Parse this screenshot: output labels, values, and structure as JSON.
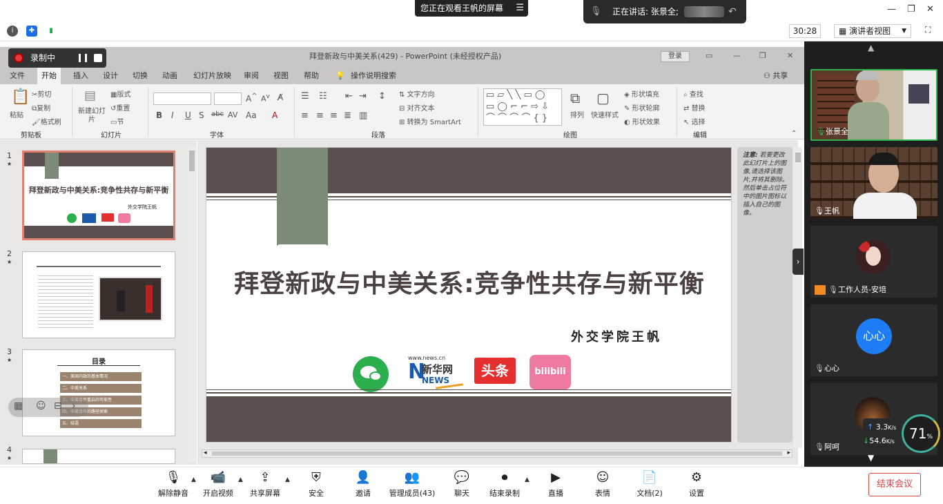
{
  "meeting": {
    "watching_text": "您正在观看王帆的屏幕",
    "speaking_text": "正在讲话: 张景全;",
    "timer": "30:28",
    "view_mode": "演讲者视图"
  },
  "recording": {
    "label": "录制中"
  },
  "powerpoint": {
    "title": "拜登新政与中美关系(429)  -  PowerPoint (未经授权产品)",
    "login": "登录",
    "tabs": [
      "文件",
      "开始",
      "插入",
      "设计",
      "切换",
      "动画",
      "幻灯片放映",
      "审阅",
      "视图",
      "帮助",
      "操作说明搜索"
    ],
    "share": "共享",
    "ribbon": {
      "paste": "粘贴",
      "cut": "剪切",
      "copy": "复制",
      "format_painter": "格式刷",
      "new_slide": "新建幻灯片",
      "layout": "版式",
      "reset": "重置",
      "section": "节",
      "text_direction": "文字方向",
      "align_text": "对齐文本",
      "smartart": "转换为 SmartArt",
      "arrange": "排列",
      "quick_styles": "快速样式",
      "shape_fill": "形状填充",
      "shape_outline": "形状轮廓",
      "shape_effects": "形状效果",
      "find": "查找",
      "replace": "替换",
      "select": "选择",
      "groups": [
        "剪贴板",
        "幻灯片",
        "字体",
        "段落",
        "绘图",
        "编辑"
      ]
    },
    "thumbs": [
      {
        "num": "1",
        "star": "★",
        "title": "拜登新政与中美关系:竞争性共存与新平衡",
        "author": "外交学院王帆"
      },
      {
        "num": "2",
        "star": "★"
      },
      {
        "num": "3",
        "star": "★",
        "title": "目录",
        "items": [
          "一、美国内政的基本情况",
          "二、中美关系",
          "三、中美合作重启的可能性",
          "四、中美合作的路径探索",
          "五、结语"
        ]
      },
      {
        "num": "4",
        "star": "★"
      }
    ],
    "slide": {
      "title": "拜登新政与中美关系:竞争性共存与新平衡",
      "author": "外交学院王帆",
      "logo_news_url": "www.news.cn",
      "logo_news_name": "新华网",
      "logo_news_letters": "NEWS",
      "logo_toutiao": "头条",
      "logo_bilibili": "bilibili"
    },
    "note": {
      "label": "注意:",
      "text": "若要更改此幻灯片上的图像,请选择该图片,并将其删除。然后单击占位符中的图片图标以插入自己的图像。"
    }
  },
  "participants": [
    {
      "name": "张景全",
      "muted": false
    },
    {
      "name": "王帆",
      "muted": false
    },
    {
      "name": "工作人员-安培",
      "muted": true
    },
    {
      "name": "心心",
      "muted": true,
      "avatar": "心心"
    },
    {
      "name": "阿呵",
      "muted": true
    }
  ],
  "network": {
    "up": "3.3",
    "up_unit": "K/s",
    "down": "54.6",
    "down_unit": "K/s",
    "cpu": "71",
    "cpu_unit": "%"
  },
  "toolbar": [
    {
      "label": "解除静音"
    },
    {
      "label": "开启视频"
    },
    {
      "label": "共享屏幕"
    },
    {
      "label": "安全"
    },
    {
      "label": "邀请"
    },
    {
      "label": "管理成员(43)"
    },
    {
      "label": "聊天"
    },
    {
      "label": "结束录制"
    },
    {
      "label": "直播"
    },
    {
      "label": "表情"
    },
    {
      "label": "文档(2)"
    },
    {
      "label": "设置"
    }
  ],
  "end_meeting": "结束会议"
}
